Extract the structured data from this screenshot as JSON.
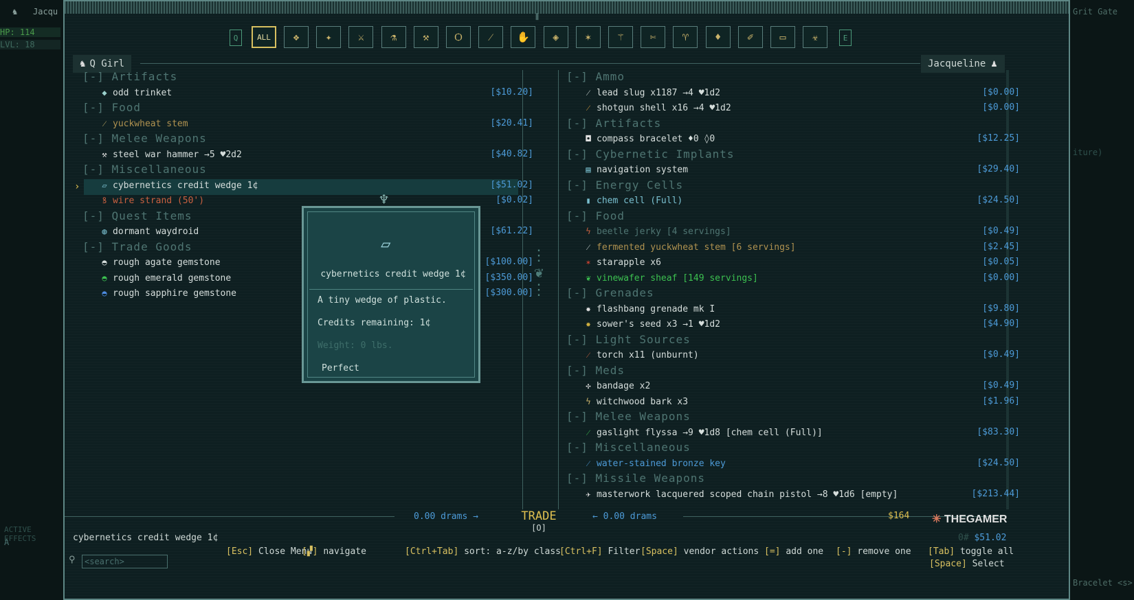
{
  "bg": {
    "left_title": "Jacqu",
    "hp": "HP: 114",
    "lvl": "LVL: 18",
    "right_title": "Grit Gate",
    "bottom_left_a": "A",
    "bottom_left_b": "ACTIVE EFFECTS",
    "right_snip1": "iture)",
    "right_snip2": "Bracelet <s>"
  },
  "filters": {
    "left_key": "Q",
    "right_key": "E",
    "all_label": "ALL",
    "icons": [
      "❖",
      "✦",
      "⚔",
      "⚗",
      "⚒",
      "Ѻ",
      "⁄",
      "✋",
      "◈",
      "✶",
      "⚚",
      "✄",
      "♈",
      "♦",
      "✐",
      "▭",
      "☣"
    ]
  },
  "left_panel": {
    "owner": "Q Girl",
    "rows": [
      {
        "kind": "cat",
        "label": "[-] Artifacts"
      },
      {
        "kind": "item",
        "icon": "◆",
        "name": "odd trinket",
        "price": "[$10.20]",
        "color": "#d6dedc",
        "icon_color": "#9ad0cc"
      },
      {
        "kind": "cat",
        "label": "[-] Food"
      },
      {
        "kind": "item",
        "icon": "⁄",
        "name": "yuckwheat stem",
        "price": "[$20.41]",
        "color": "#b09250",
        "icon_color": "#c9b26a"
      },
      {
        "kind": "cat",
        "label": "[-] Melee Weapons"
      },
      {
        "kind": "item",
        "icon": "⚒",
        "name": "steel war hammer →5 ♥2d2",
        "price": "[$40.82]",
        "color": "#d6dedc",
        "icon_color": "#e0e0e0"
      },
      {
        "kind": "cat",
        "label": "[-] Miscellaneous"
      },
      {
        "kind": "item",
        "icon": "▱",
        "name": "cybernetics credit wedge 1¢",
        "price": "[$51.02]",
        "color": "#d6dedc",
        "icon_color": "#7ac0d0"
      },
      {
        "kind": "item",
        "icon": "ꝸ",
        "name": "wire strand (50')",
        "price": "[$0.02]",
        "color": "#c86040",
        "icon_color": "#c86040"
      },
      {
        "kind": "cat",
        "label": "[-] Quest Items"
      },
      {
        "kind": "item",
        "icon": "◍",
        "name": "dormant waydroid",
        "price": "[$61.22]",
        "color": "#d6dedc",
        "icon_color": "#7ac0d0"
      },
      {
        "kind": "cat",
        "label": "[-] Trade Goods"
      },
      {
        "kind": "item",
        "icon": "◓",
        "name": "rough agate gemstone",
        "price": "[$100.00]",
        "color": "#d6dedc",
        "icon_color": "#d6dedc"
      },
      {
        "kind": "item",
        "icon": "◓",
        "name": "rough emerald gemstone",
        "price": "[$350.00]",
        "color": "#d6dedc",
        "icon_color": "#3cc050"
      },
      {
        "kind": "item",
        "icon": "◓",
        "name": "rough sapphire gemstone",
        "price": "[$300.00]",
        "color": "#d6dedc",
        "icon_color": "#4d8be0"
      }
    ]
  },
  "right_panel": {
    "owner": "Jacqueline",
    "rows": [
      {
        "kind": "cat",
        "label": "[-] Ammo"
      },
      {
        "kind": "item",
        "icon": "⁄",
        "name": "lead slug x1187 →4 ♥1d2",
        "price": "[$0.00]",
        "color": "#d6dedc",
        "icon_color": "#d6dedc"
      },
      {
        "kind": "item",
        "icon": "⁄",
        "name": "shotgun shell x16 →4 ♥1d2",
        "price": "[$0.00]",
        "color": "#d6dedc",
        "icon_color": "#e0a040"
      },
      {
        "kind": "cat",
        "label": "[-] Artifacts"
      },
      {
        "kind": "item",
        "icon": "◘",
        "name": "compass bracelet ♦0 ◊0",
        "price": "[$12.25]",
        "color": "#d6dedc",
        "icon_color": "#e0e0e0"
      },
      {
        "kind": "cat",
        "label": "[-] Cybernetic Implants"
      },
      {
        "kind": "item",
        "icon": "▤",
        "name": "navigation system",
        "price": "[$29.40]",
        "color": "#d6dedc",
        "icon_color": "#7ac0d0"
      },
      {
        "kind": "cat",
        "label": "[-] Energy Cells"
      },
      {
        "kind": "item",
        "icon": "▮",
        "name": "chem cell (Full)",
        "price": "[$24.50]",
        "color": "#7ac0d0",
        "icon_color": "#7ac0d0"
      },
      {
        "kind": "cat",
        "label": "[-] Food"
      },
      {
        "kind": "item",
        "icon": "ϟ",
        "name": "beetle jerky [4 servings]",
        "price": "[$0.49]",
        "color": "#4f7572",
        "icon_color": "#c86040"
      },
      {
        "kind": "item",
        "icon": "⁄",
        "name": "fermented yuckwheat stem [6 servings]",
        "price": "[$2.45]",
        "color": "#b09250",
        "icon_color": "#d6dedc"
      },
      {
        "kind": "item",
        "icon": "✶",
        "name": "starapple x6",
        "price": "[$0.05]",
        "color": "#d6dedc",
        "icon_color": "#c84030"
      },
      {
        "kind": "item",
        "icon": "❦",
        "name": "vinewafer sheaf [149 servings]",
        "price": "[$0.00]",
        "color": "#3cc050",
        "icon_color": "#3cc050"
      },
      {
        "kind": "cat",
        "label": "[-] Grenades"
      },
      {
        "kind": "item",
        "icon": "✸",
        "name": "flashbang grenade mk I",
        "price": "[$9.80]",
        "color": "#d6dedc",
        "icon_color": "#e0e0e0"
      },
      {
        "kind": "item",
        "icon": "✸",
        "name": "sower's seed x3 →1 ♥1d2",
        "price": "[$4.90]",
        "color": "#d6dedc",
        "icon_color": "#d0b040"
      },
      {
        "kind": "cat",
        "label": "[-] Light Sources"
      },
      {
        "kind": "item",
        "icon": "⁄",
        "name": "torch x11 (unburnt)",
        "price": "[$0.49]",
        "color": "#d6dedc",
        "icon_color": "#c86040"
      },
      {
        "kind": "cat",
        "label": "[-] Meds"
      },
      {
        "kind": "item",
        "icon": "✣",
        "name": "bandage x2",
        "price": "[$0.49]",
        "color": "#d6dedc",
        "icon_color": "#e0e0e0"
      },
      {
        "kind": "item",
        "icon": "ϟ",
        "name": "witchwood bark x3",
        "price": "[$1.96]",
        "color": "#d6dedc",
        "icon_color": "#c9b26a"
      },
      {
        "kind": "cat",
        "label": "[-] Melee Weapons"
      },
      {
        "kind": "item",
        "icon": "⁄",
        "name": "gaslight flyssa →9 ♥1d8 [chem cell (Full)]",
        "price": "[$83.30]",
        "color": "#d6dedc",
        "icon_color": "#3cc050"
      },
      {
        "kind": "cat",
        "label": "[-] Miscellaneous"
      },
      {
        "kind": "item",
        "icon": "⁄",
        "name": "water-stained bronze key",
        "price": "[$24.50]",
        "color": "#4d9bd8",
        "icon_color": "#4d9bd8"
      },
      {
        "kind": "cat",
        "label": "[-] Missile Weapons"
      },
      {
        "kind": "item",
        "icon": "✈",
        "name": "masterwork lacquered scoped chain pistol →8 ♥1d6 [empty]",
        "price": "[$213.44]",
        "color": "#d6dedc",
        "icon_color": "#e0e0e0"
      }
    ]
  },
  "tooltip": {
    "title": "cybernetics credit wedge 1¢",
    "desc": "A tiny wedge of plastic.",
    "credits": "Credits remaining: 1¢",
    "weight": "Weight: 0 lbs.",
    "condition": "Perfect"
  },
  "trade": {
    "label": "TRADE",
    "key": "[O]",
    "left_drams": "0.00 drams →",
    "right_drams": "← 0.00 drams",
    "money": "$164",
    "total": "$51.02",
    "total_prefix": "0#"
  },
  "footer": {
    "selected_item": "cybernetics credit wedge 1¢",
    "search_placeholder": "<search>",
    "hints": [
      {
        "key": "[Esc]",
        "label": "Close Menu"
      },
      {
        "key": "[▞]",
        "label": "navigate"
      },
      {
        "key": "[Ctrl+Tab]",
        "label": "sort: a-z/by class"
      },
      {
        "key": "[Ctrl+F]",
        "label": "Filter"
      },
      {
        "key": "[Space]",
        "label": "vendor actions"
      },
      {
        "key": "[=]",
        "label": "add one"
      },
      {
        "key": "[-]",
        "label": "remove one"
      },
      {
        "key": "[Tab]",
        "label": "toggle all"
      }
    ],
    "select_key": "[Space]",
    "select_label": "Select"
  },
  "watermark": {
    "a": "THE",
    "b": "GAMER"
  },
  "colors": {
    "accent": "#d8c060",
    "price": "#4d9bd8",
    "frame": "#5e8785",
    "panel": "#0e1f21"
  }
}
